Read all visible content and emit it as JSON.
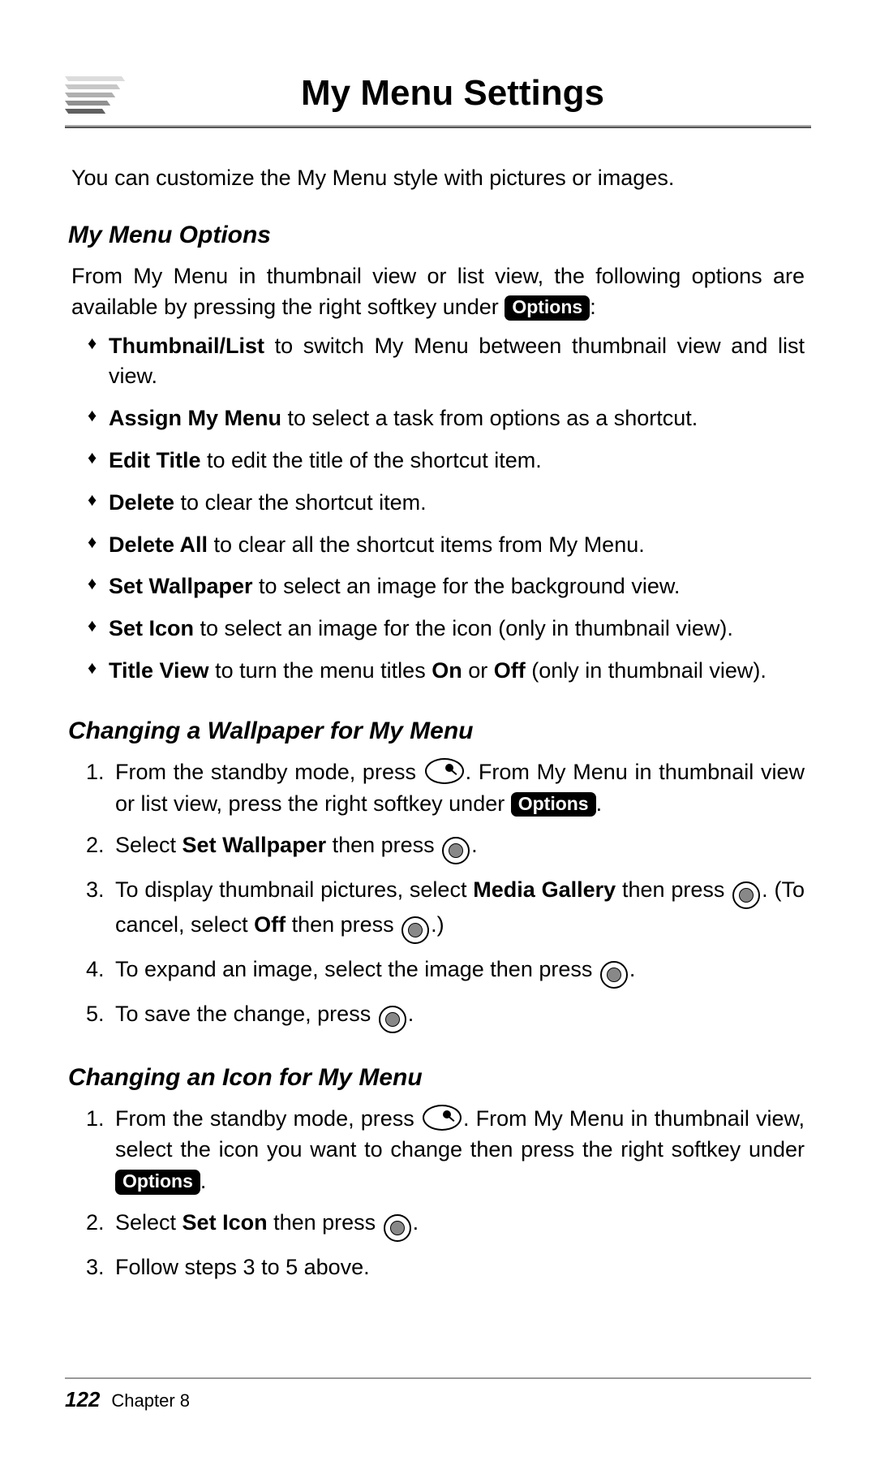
{
  "title": "My Menu Settings",
  "intro": "You can customize the My Menu style with pictures or images.",
  "options_pill": "Options",
  "s1": {
    "heading": "My Menu Options",
    "lead_a": "From My Menu in thumbnail view or list view, the following options are available by pressing the right softkey under ",
    "lead_b": ":",
    "items": [
      {
        "b": "Thumbnail/List",
        "t": " to switch My Menu between thumbnail view and list view."
      },
      {
        "b": "Assign My Menu",
        "t": " to select a task from options as a shortcut."
      },
      {
        "b": "Edit Title",
        "t": " to edit the title of the shortcut item."
      },
      {
        "b": "Delete",
        "t": " to clear the shortcut item."
      },
      {
        "b": "Delete All",
        "t": " to clear all the shortcut items from My Menu."
      },
      {
        "b": "Set Wallpaper",
        "t": " to select an image for the background view."
      },
      {
        "b": "Set Icon",
        "t": " to select an image for the icon (only in thumbnail view)."
      }
    ],
    "item8_a": "Title View",
    "item8_b": " to turn the menu titles ",
    "item8_on": "On",
    "item8_c": " or ",
    "item8_off": "Off",
    "item8_d": " (only in thumbnail view)."
  },
  "s2": {
    "heading": "Changing a Wallpaper for My Menu",
    "st1a": "From the standby mode, press ",
    "st1b": ". From My Menu in thumbnail view or list view, press the right softkey under ",
    "st1c": ".",
    "st2a": "Select ",
    "st2b": "Set Wallpaper",
    "st2c": " then press ",
    "st2d": ".",
    "st3a": "To display thumbnail pictures, select ",
    "st3b": "Media Gallery",
    "st3c": " then press ",
    "st3d": ". (To cancel, select ",
    "st3e": "Off",
    "st3f": " then press ",
    "st3g": ".)",
    "st4a": "To expand an image, select the image then press ",
    "st4b": ".",
    "st5a": "To save the change, press ",
    "st5b": "."
  },
  "s3": {
    "heading": "Changing an Icon for My Menu",
    "st1a": "From the standby mode, press ",
    "st1b": ". From My Menu in thumbnail view, select the icon you want to change then press the right softkey under ",
    "st1c": ".",
    "st2a": "Select ",
    "st2b": "Set Icon",
    "st2c": " then press ",
    "st2d": ".",
    "st3": "Follow steps 3 to 5 above."
  },
  "footer": {
    "page": "122",
    "chapter": "Chapter 8"
  }
}
